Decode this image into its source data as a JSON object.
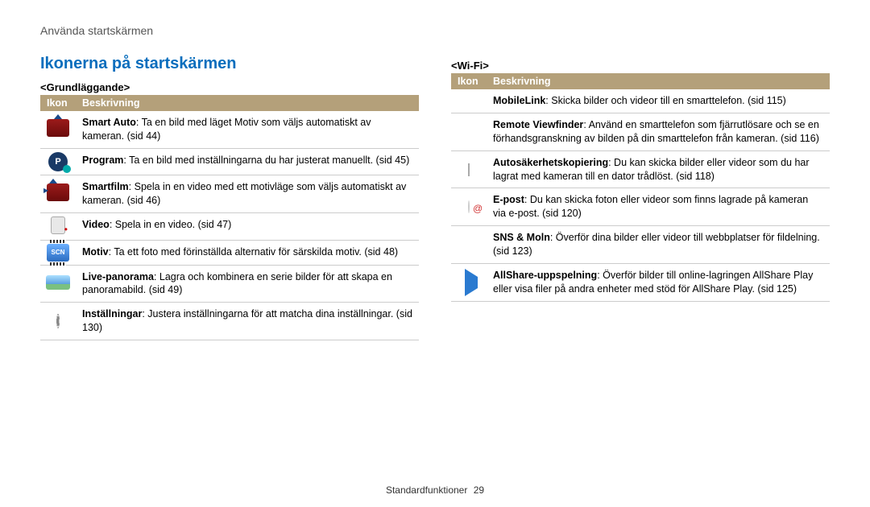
{
  "breadcrumb": "Använda startskärmen",
  "section_title": "Ikonerna på startskärmen",
  "left": {
    "subhead": "<Grundläggande>",
    "headers": {
      "icon": "Ikon",
      "desc": "Beskrivning"
    },
    "rows": [
      {
        "bold": "Smart Auto",
        "rest": ": Ta en bild med läget Motiv som väljs automatiskt av kameran. (sid 44)",
        "icon": "smart-auto-icon"
      },
      {
        "bold": "Program",
        "rest": ": Ta en bild med inställningarna du har justerat manuellt. (sid 45)",
        "icon": "program-icon"
      },
      {
        "bold": "Smartfilm",
        "rest": ": Spela in en video med ett motivläge som väljs automatiskt av kameran. (sid 46)",
        "icon": "smartfilm-icon"
      },
      {
        "bold": "Video",
        "rest": ": Spela in en video. (sid 47)",
        "icon": "video-icon"
      },
      {
        "bold": "Motiv",
        "rest": ": Ta ett foto med förinställda alternativ för särskilda motiv. (sid 48)",
        "icon": "scene-icon"
      },
      {
        "bold": "Live-panorama",
        "rest": ": Lagra och kombinera en serie bilder för att skapa en panoramabild. (sid 49)",
        "icon": "panorama-icon"
      },
      {
        "bold": "Inställningar",
        "rest": ": Justera inställningarna för att matcha dina inställningar. (sid 130)",
        "icon": "settings-icon"
      }
    ]
  },
  "right": {
    "subhead": "<Wi-Fi>",
    "headers": {
      "icon": "Ikon",
      "desc": "Beskrivning"
    },
    "rows": [
      {
        "bold": "MobileLink",
        "rest": ": Skicka bilder och videor till en smarttelefon. (sid 115)",
        "icon": "mobilelink-icon"
      },
      {
        "bold": "Remote Viewfinder",
        "rest": ": Använd en smarttelefon som fjärrutlösare och se en förhandsgranskning av bilden på din smarttelefon från kameran. (sid 116)",
        "icon": "remote-viewfinder-icon"
      },
      {
        "bold": "Autosäkerhetskopiering",
        "rest": ": Du kan skicka bilder eller videor som du har lagrat med kameran till en dator trådlöst. (sid 118)",
        "icon": "auto-backup-icon"
      },
      {
        "bold": "E-post",
        "rest": ": Du kan skicka foton eller videor som finns lagrade på kameran via e-post. (sid 120)",
        "icon": "email-icon"
      },
      {
        "bold": "SNS & Moln",
        "rest": ": Överför dina bilder eller videor till webbplatser för fildelning. (sid 123)",
        "icon": "sns-cloud-icon"
      },
      {
        "bold": "AllShare-uppspelning",
        "rest": ": Överför bilder till online-lagringen AllShare Play eller visa filer på andra enheter med stöd för AllShare Play. (sid 125)",
        "icon": "allshare-icon"
      }
    ]
  },
  "footer": {
    "label": "Standardfunktioner",
    "page": "29"
  }
}
